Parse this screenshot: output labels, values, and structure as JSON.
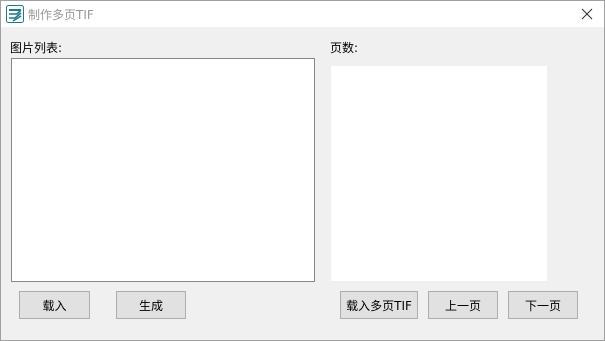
{
  "window": {
    "title": "制作多页TIF",
    "app_icon": "app-logo-icon",
    "close_icon": "close-icon"
  },
  "left_panel": {
    "label": "图片列表:",
    "buttons": {
      "load": "载入",
      "generate": "生成"
    }
  },
  "right_panel": {
    "label": "页数:",
    "buttons": {
      "load_multipage": "载入多页TIF",
      "prev_page": "上一页",
      "next_page": "下一页"
    }
  },
  "colors": {
    "window_bg": "#f0f0f0",
    "titlebar_bg": "#ffffff",
    "button_bg": "#e1e1e1",
    "button_border": "#adadad",
    "icon_teal": "#1f7a8c"
  }
}
